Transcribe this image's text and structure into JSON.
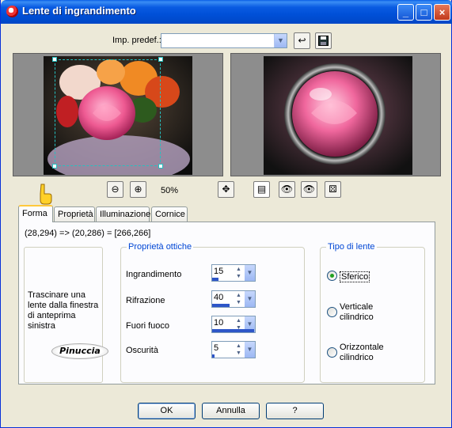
{
  "window": {
    "title": "Lente di ingrandimento",
    "minimize": "_",
    "maximize": "□",
    "close": "×"
  },
  "preset": {
    "label": "Imp. predef.:",
    "value": ""
  },
  "zoom": {
    "level": "50%"
  },
  "tabs": [
    {
      "label": "Forma",
      "active": true
    },
    {
      "label": "Proprietà",
      "active": false
    },
    {
      "label": "Illuminazione",
      "active": false
    },
    {
      "label": "Cornice",
      "active": false
    }
  ],
  "coords_text": "(28,294) => (20,286) = [266,266]",
  "hint": {
    "text": "Trascinare una lente dalla finestra di anteprima sinistra",
    "watermark": "Pinuccia"
  },
  "optics": {
    "title": "Proprietà ottiche",
    "fields": [
      {
        "label": "Ingrandimento",
        "value": "15",
        "fill": 0.15
      },
      {
        "label": "Rifrazione",
        "value": "40",
        "fill": 0.4
      },
      {
        "label": "Fuori fuoco",
        "value": "10",
        "fill": 0.99
      },
      {
        "label": "Oscurità",
        "value": "5",
        "fill": 0.05
      }
    ]
  },
  "lens_type": {
    "title": "Tipo di lente",
    "options": [
      {
        "label": "Sferico",
        "checked": true
      },
      {
        "label": "Verticale cilindrico",
        "checked": false
      },
      {
        "label": "Orizzontale cilindrico",
        "checked": false
      }
    ]
  },
  "buttons": {
    "ok": "OK",
    "cancel": "Annulla",
    "help": "?"
  },
  "colors": {
    "title_bar": "#0A5CE2",
    "dialog_bg": "#ECE9D8",
    "group_title": "#0046D5",
    "tab_highlight": "#FFC83C"
  }
}
